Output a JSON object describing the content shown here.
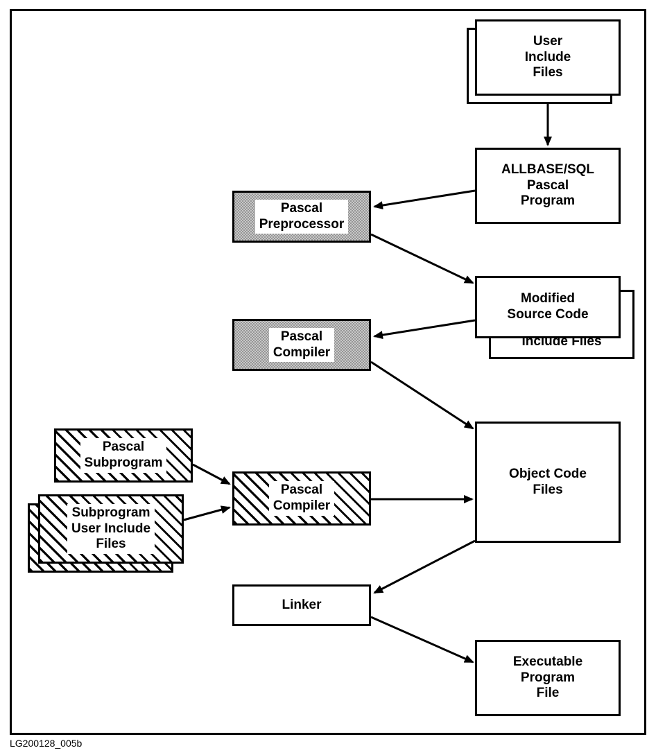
{
  "diagram": {
    "footer_id": "LG200128_005b",
    "nodes": {
      "user_include_files": "User\nInclude\nFiles",
      "allbase_program": "ALLBASE/SQL\nPascal\nProgram",
      "pascal_preprocessor": "Pascal\nPreprocessor",
      "modified_source_code": "Modified\nSource Code",
      "preprocessor_include_files": "Preprocessor\nInclude Files",
      "pascal_compiler_1": "Pascal\nCompiler",
      "pascal_compiler_2": "Pascal\nCompiler",
      "pascal_subprogram": "Pascal\nSubprogram",
      "subprogram_user_include_files": "Subprogram\nUser Include\nFiles",
      "object_code_files": "Object Code\nFiles",
      "linker": "Linker",
      "executable_program_file": "Executable\nProgram\nFile"
    }
  }
}
